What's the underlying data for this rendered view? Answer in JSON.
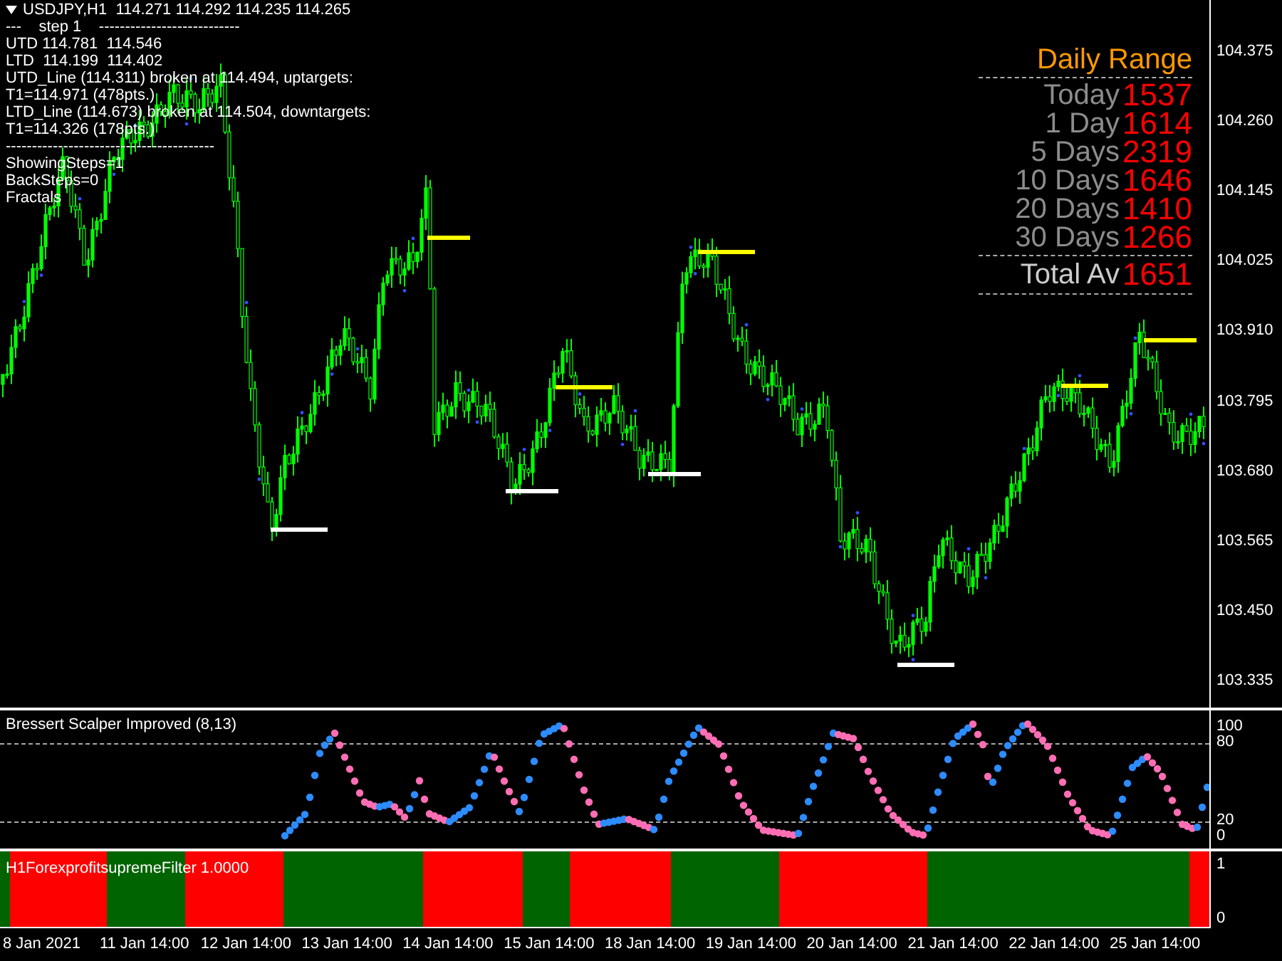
{
  "chart_header": {
    "symbol_line": "USDJPY,H1  114.271 114.292 114.235 114.265"
  },
  "info_lines": [
    "---    step 1    ---------------------------",
    "UTD 114.781  114.546",
    "LTD  114.199  114.402",
    "UTD_Line (114.311) broken at 114.494, uptargets:",
    "T1=114.971 (478pts.)",
    "LTD_Line (114.673) broken at 114.504, downtargets:",
    "T1=114.326 (178pts.)",
    "----------------------------------------",
    "ShowingSteps=1",
    "BackSteps=0",
    "Fractals"
  ],
  "daily_range": {
    "title": "Daily Range",
    "rows": [
      {
        "label": "Today",
        "value": "1537"
      },
      {
        "label": "1 Day",
        "value": "1614"
      },
      {
        "label": "5 Days",
        "value": "2319"
      },
      {
        "label": "10 Days",
        "value": "1646"
      },
      {
        "label": "20 Days",
        "value": "1410"
      },
      {
        "label": "30 Days",
        "value": "1266"
      }
    ],
    "total": {
      "label": "Total Av",
      "value": "1651"
    }
  },
  "price_axis": [
    "104.375",
    "104.260",
    "104.145",
    "104.025",
    "103.910",
    "103.795",
    "103.680",
    "103.565",
    "103.450",
    "103.335"
  ],
  "oscillator": {
    "title": "Bressert Scalper Improved (8,13)",
    "axis": [
      "100",
      "80",
      "20",
      "0"
    ]
  },
  "filter": {
    "title": "H1ForexprofitsupremeFilter 1.0000",
    "axis": [
      "1",
      "0"
    ]
  },
  "time_axis": [
    "8 Jan 2021",
    "11 Jan 14:00",
    "12 Jan 14:00",
    "13 Jan 14:00",
    "14 Jan 14:00",
    "15 Jan 14:00",
    "18 Jan 14:00",
    "19 Jan 14:00",
    "20 Jan 14:00",
    "21 Jan 14:00",
    "22 Jan 14:00",
    "25 Jan 14:00"
  ]
}
